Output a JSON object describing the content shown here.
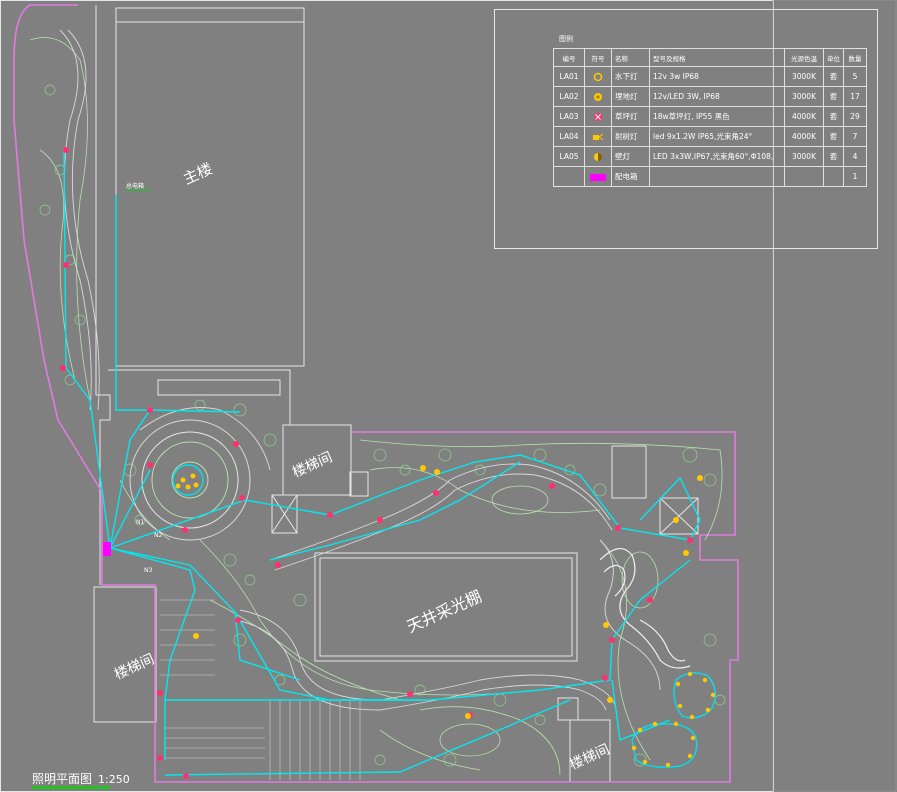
{
  "drawing": {
    "title": "照明平面图",
    "scale": "1:250",
    "labels": {
      "main_building": "主楼",
      "stair_top": "楼梯间",
      "stair_left": "楼梯间",
      "stair_bottom": "楼梯间",
      "skylight": "天井采光棚",
      "panel": "总电箱",
      "circuit_1": "N1",
      "circuit_2": "N2",
      "circuit_3": "N3"
    }
  },
  "legend": {
    "title": "图例",
    "headers": [
      "编号",
      "符号",
      "名称",
      "型号及规格",
      "光源色温",
      "单位",
      "数量"
    ],
    "rows": [
      {
        "code": "LA01",
        "symbol": "underwater-light-icon",
        "name": "水下灯",
        "spec": "12v 3w    IP68",
        "color": "3000K",
        "unit": "套",
        "qty": "5"
      },
      {
        "code": "LA02",
        "symbol": "buried-light-icon",
        "name": "埋地灯",
        "spec": "12v/LED 3W,   IP68",
        "color": "3000K",
        "unit": "套",
        "qty": "17"
      },
      {
        "code": "LA03",
        "symbol": "tree-light-icon",
        "name": "草坪灯",
        "spec": "18w草坪灯, IP55        黑色",
        "color": "4000K",
        "unit": "套",
        "qty": "29"
      },
      {
        "code": "LA04",
        "symbol": "spot-light-icon",
        "name": "射树灯",
        "spec": "led 9x1.2W  IP65,光束角24°",
        "color": "4000K",
        "unit": "套",
        "qty": "7"
      },
      {
        "code": "LA05",
        "symbol": "wall-light-icon",
        "name": "壁灯",
        "spec": "LED 3x3W,IP67,光束角60°,Φ108,",
        "color": "3000K",
        "unit": "套",
        "qty": "4"
      },
      {
        "code": "",
        "symbol": "distribution-box-icon",
        "name": "配电箱",
        "spec": "",
        "color": "",
        "unit": "",
        "qty": "1"
      }
    ]
  },
  "colors": {
    "cable": "#00e8f0",
    "boundary": "#e07be0",
    "planting": "#b8e0b0",
    "structure": "#e6e6e6",
    "panel": "#ff00ff",
    "fixture": "#ffc800",
    "tree_light": "#ff3070"
  }
}
